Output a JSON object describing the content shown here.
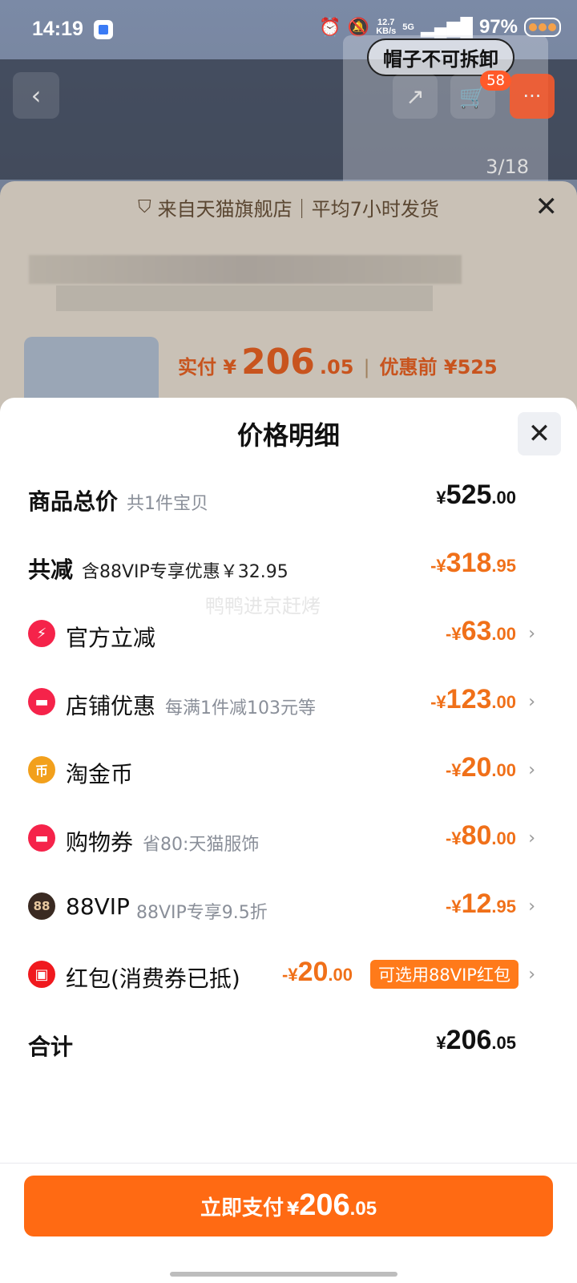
{
  "status_bar": {
    "time": "14:19",
    "speed_value": "12.7",
    "speed_unit": "KB/s",
    "network": "5G",
    "battery": "97%"
  },
  "background_page": {
    "thumb_tag": "帽子不可拆卸",
    "cart_count": "58",
    "image_counter": "3/18",
    "banner_text": "来自天猫旗舰店｜平均7小时发货",
    "price_prefix": "实付 ¥",
    "price_int": "206",
    "price_dec": ".05",
    "price_before": "优惠前 ¥525"
  },
  "sheet": {
    "title": "价格明细",
    "watermark": "鸭鸭进京赶烤",
    "rows": [
      {
        "label": "商品总价",
        "sub": "共1件宝贝",
        "cur": "¥",
        "int": "525",
        "dec": ".00"
      },
      {
        "label": "共减",
        "sub": "含88VIP专享优惠￥32.95",
        "cur": "-¥",
        "int": "318",
        "dec": ".95"
      },
      {
        "label": "官方立减",
        "sub": "",
        "cur": "-¥",
        "int": "63",
        "dec": ".00",
        "icon": "lightning-icon",
        "icon_glyph": "⚡",
        "icon_color": "#f5234a"
      },
      {
        "label": "店铺优惠",
        "sub": "每满1件减103元等",
        "cur": "-¥",
        "int": "123",
        "dec": ".00",
        "icon": "store-coupon-icon",
        "icon_glyph": "▬",
        "icon_color": "#f5234a"
      },
      {
        "label": "淘金币",
        "sub": "",
        "cur": "-¥",
        "int": "20",
        "dec": ".00",
        "icon": "gold-coin-icon",
        "icon_glyph": "币",
        "icon_color": "#f2a01c"
      },
      {
        "label": "购物券",
        "sub": "省80:天猫服饰",
        "cur": "-¥",
        "int": "80",
        "dec": ".00",
        "icon": "shopping-voucher-icon",
        "icon_glyph": "▬",
        "icon_color": "#f5234a"
      },
      {
        "label": "88VIP",
        "sub": "88VIP专享9.5折",
        "cur": "-¥",
        "int": "12",
        "dec": ".95",
        "icon": "vip88-icon",
        "icon_glyph": "88",
        "icon_color": "#3a2a22"
      },
      {
        "label": "红包(消费券已抵)",
        "sub": "",
        "cur": "-¥",
        "int": "20",
        "dec": ".00",
        "icon": "red-packet-icon",
        "icon_glyph": "▣",
        "icon_color": "#f0191e",
        "pill": "可选用88VIP红包"
      },
      {
        "label": "合计",
        "sub": "",
        "cur": "¥",
        "int": "206",
        "dec": ".05"
      }
    ]
  },
  "pay_button": {
    "label": "立即支付",
    "cur": "¥",
    "int": "206",
    "dec": ".05"
  },
  "colors": {
    "accent_orange": "#ff6a13",
    "discount_orange": "#f07019",
    "text_dark": "#111111"
  }
}
